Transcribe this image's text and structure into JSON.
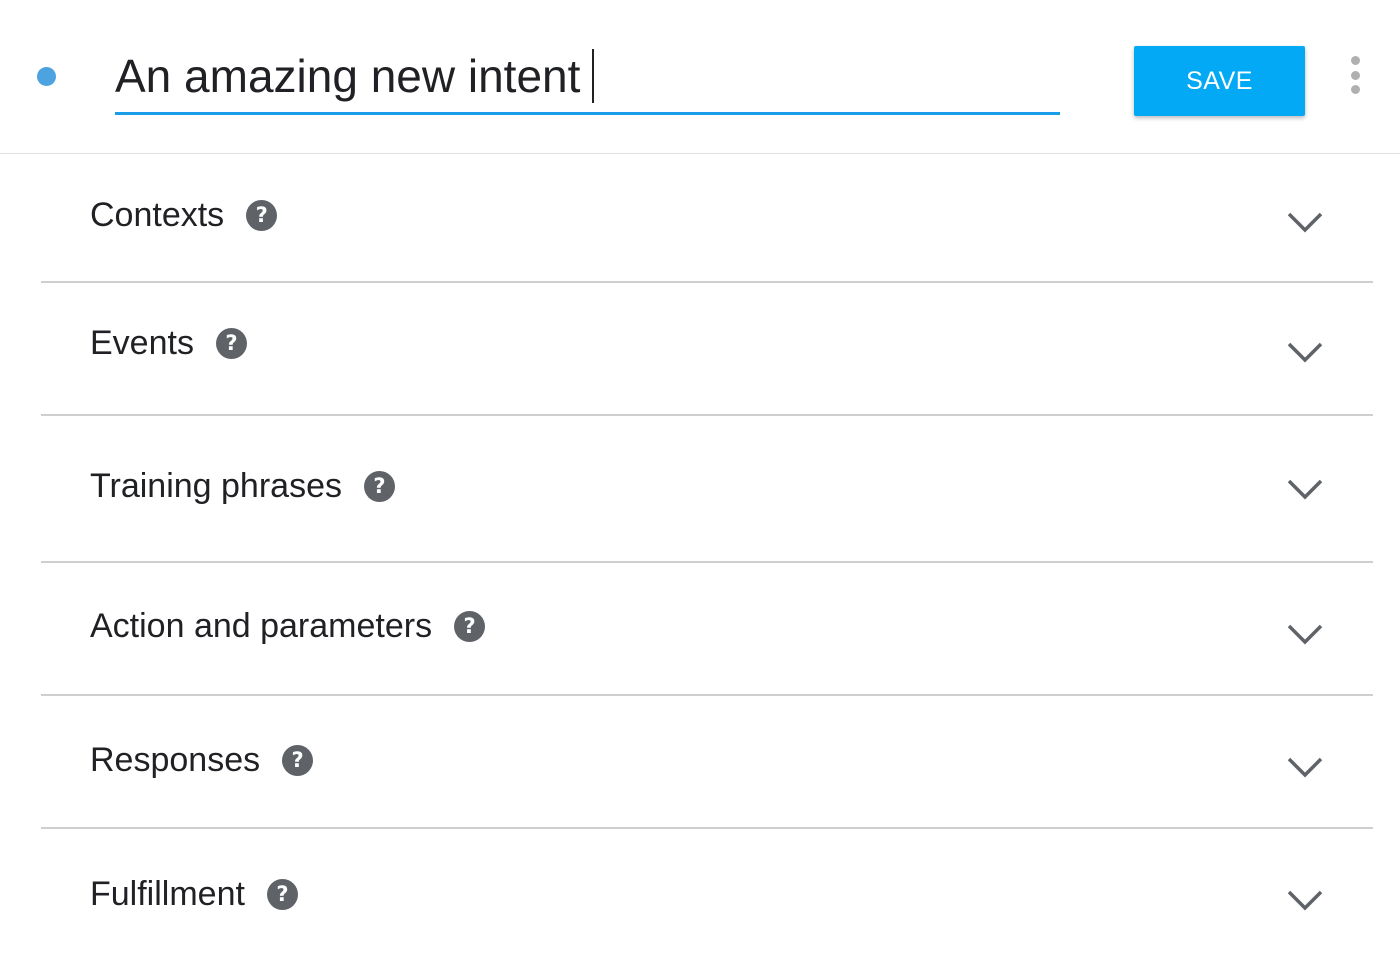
{
  "header": {
    "title_value": "An amazing new intent",
    "save_label": "SAVE",
    "status_dot_color": "#4da3e0",
    "accent_color": "#03a9f4",
    "more_icon": "more-vert-icon"
  },
  "sections": [
    {
      "label": "Contexts",
      "icon": "help-icon",
      "expand_icon": "chevron-down-icon"
    },
    {
      "label": "Events",
      "icon": "help-icon",
      "expand_icon": "chevron-down-icon"
    },
    {
      "label": "Training phrases",
      "icon": "help-icon",
      "expand_icon": "chevron-down-icon"
    },
    {
      "label": "Action and parameters",
      "icon": "help-icon",
      "expand_icon": "chevron-down-icon"
    },
    {
      "label": "Responses",
      "icon": "help-icon",
      "expand_icon": "chevron-down-icon"
    },
    {
      "label": "Fulfillment",
      "icon": "help-icon",
      "expand_icon": "chevron-down-icon"
    }
  ]
}
